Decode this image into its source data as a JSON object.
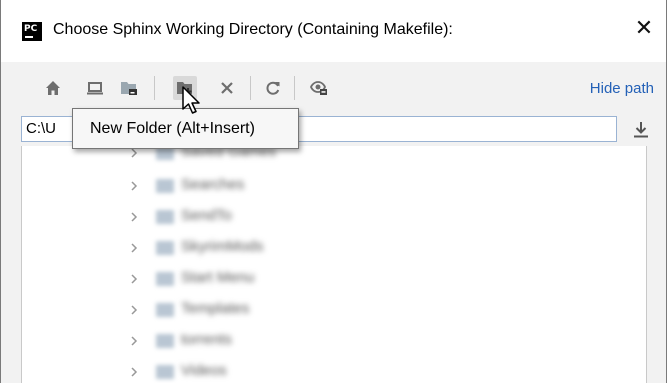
{
  "window": {
    "app_icon_text": "PC",
    "title": "Choose Sphinx Working Directory (Containing Makefile):",
    "close_glyph": "✕"
  },
  "toolbar": {
    "buttons": [
      {
        "icon": "home-icon"
      },
      {
        "icon": "desktop-icon"
      },
      {
        "icon": "project-folder-icon"
      },
      {
        "icon": "new-folder-icon"
      },
      {
        "icon": "delete-icon"
      },
      {
        "icon": "refresh-icon"
      },
      {
        "icon": "show-hidden-icon"
      }
    ],
    "hide_path_label": "Hide path"
  },
  "path": {
    "value": "C:\\U"
  },
  "tooltip": {
    "text": "New Folder (Alt+Insert)"
  },
  "tree": {
    "items": [
      {
        "label": "Saved Games"
      },
      {
        "label": "Searches"
      },
      {
        "label": "SendTo"
      },
      {
        "label": "SkyrimMods"
      },
      {
        "label": "Start Menu"
      },
      {
        "label": "Templates"
      },
      {
        "label": "torrents"
      },
      {
        "label": "Videos"
      }
    ]
  },
  "colors": {
    "link": "#2461b7",
    "toolbar_bg": "#f2f2f2",
    "icon_gray": "#6e6e6e"
  }
}
